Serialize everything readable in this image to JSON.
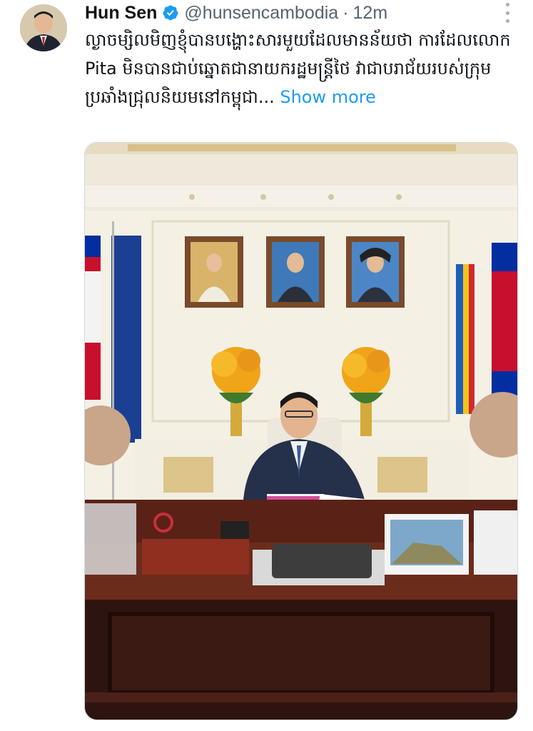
{
  "tweet": {
    "author_name": "Hun Sen",
    "handle": "@hunsencambodia",
    "separator": "·",
    "time": "12m",
    "text": "ល្ងាចម្សិលមិញខ្ញុំបានបង្ហោះសារមួយដែលមានន័យថា ការដែលលោក Pita មិនបានជាប់ឆ្នោតជានាយករដ្ឋមន្ត្រីថៃ វាជាបរាជ័យរបស់ក្រុមប្រឆាំងជ្រុលនិយមនៅកម្ពុជា...",
    "show_more": "Show more",
    "verified_color": "#1d9bf0",
    "icons": {
      "verified": "verified-badge-icon",
      "more": "more-options-icon"
    }
  }
}
